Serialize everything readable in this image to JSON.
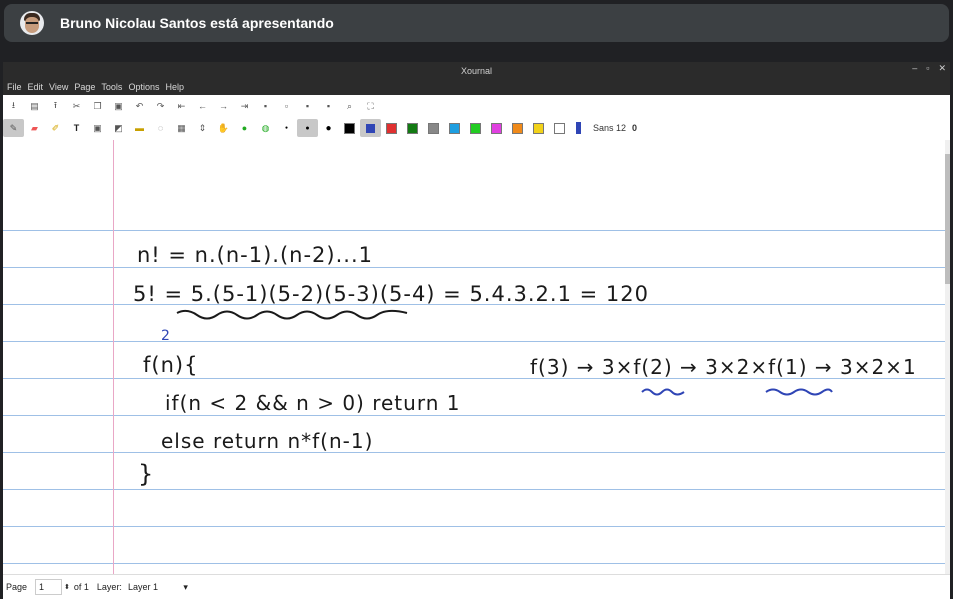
{
  "presenter": {
    "text": "Bruno Nicolau Santos está apresentando"
  },
  "window": {
    "title": "Xournal",
    "controls": {
      "minimize": "–",
      "maximize": "▫",
      "close": "✕"
    }
  },
  "menu": [
    "File",
    "Edit",
    "View",
    "Page",
    "Tools",
    "Options",
    "Help"
  ],
  "toolbar1": [
    {
      "icon": "save-icon"
    },
    {
      "icon": "new-page-icon"
    },
    {
      "icon": "export-icon"
    },
    {
      "icon": "cut-icon"
    },
    {
      "icon": "copy-icon"
    },
    {
      "icon": "paste-icon"
    },
    {
      "icon": "undo-icon"
    },
    {
      "icon": "redo-icon"
    },
    {
      "icon": "first-page-icon"
    },
    {
      "icon": "previous-page-icon"
    },
    {
      "icon": "next-page-icon"
    },
    {
      "icon": "last-page-icon"
    },
    {
      "icon": "zoom-out-icon"
    },
    {
      "icon": "zoom-100-icon"
    },
    {
      "icon": "zoom-width-icon"
    },
    {
      "icon": "zoom-in-icon"
    },
    {
      "icon": "search-icon"
    },
    {
      "icon": "fullscreen-icon"
    }
  ],
  "toolbar2": {
    "tools": [
      {
        "icon": "pen-icon",
        "active": true
      },
      {
        "icon": "eraser-icon"
      },
      {
        "icon": "highlighter-icon"
      },
      {
        "icon": "text-tool-icon"
      },
      {
        "icon": "image-tool-icon"
      },
      {
        "icon": "shape-icon"
      },
      {
        "icon": "ruler-icon"
      },
      {
        "icon": "lasso-select-icon"
      },
      {
        "icon": "rect-select-icon"
      },
      {
        "icon": "vertical-space-icon"
      },
      {
        "icon": "hand-icon"
      },
      {
        "icon": "default-pen-icon"
      },
      {
        "icon": "default-tool-icon"
      }
    ],
    "thickness": [
      "fine",
      "medium",
      "thick"
    ],
    "colors": [
      "#000000",
      "#2f45b5",
      "#e03030",
      "#137a13",
      "#888888",
      "#1e9ee0",
      "#22cc22",
      "#e040e0",
      "#f08a1a",
      "#f2d21a",
      "#ffffff"
    ],
    "selected_color": "#2f45b5",
    "font": "Sans 12",
    "font_extra": "0"
  },
  "ink": {
    "line1": "n! = n.(n-1).(n-2)...1",
    "line2": "5! = 5.(5-1)(5-2)(5-3)(5-4) = 5.4.3.2.1 = 120",
    "superscript": "2",
    "code1": "f(n){",
    "code2": "if(n < 2 && n > 0) return 1",
    "code3": "else return n*f(n-1)",
    "code4": "}",
    "chain": "f(3) → 3×f(2) → 3×2×f(1) → 3×2×1"
  },
  "status": {
    "page_label": "Page",
    "page_value": "1",
    "of_label": "of 1",
    "layer_label": "Layer:",
    "layer_value": "Layer 1"
  }
}
